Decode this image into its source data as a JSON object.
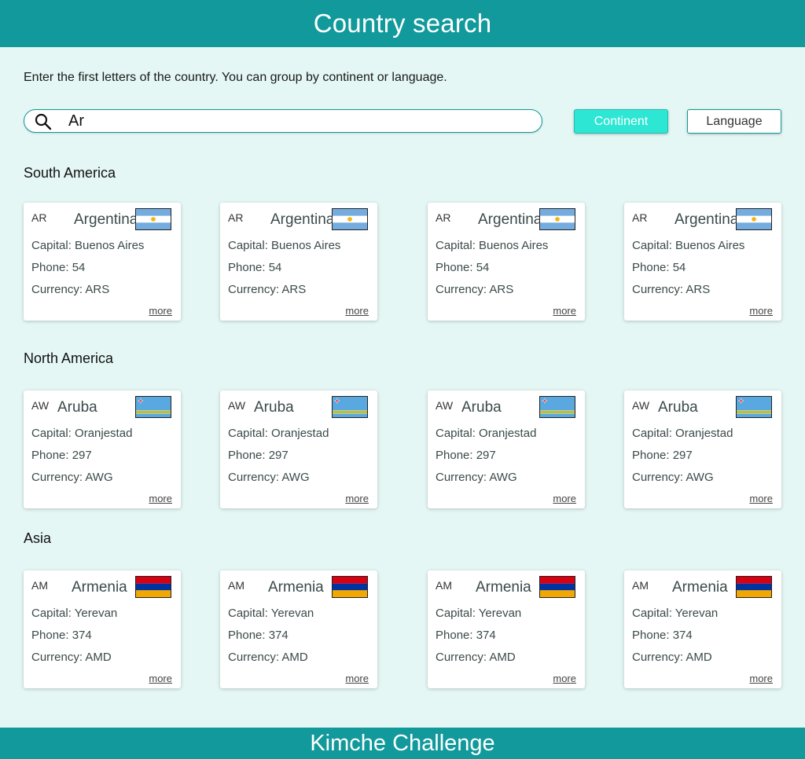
{
  "header": {
    "title": "Country search"
  },
  "instructions": "Enter the first letters of the country. You can group by continent or language.",
  "search": {
    "value": "Ar",
    "icon": "search-icon"
  },
  "group_buttons": {
    "continent": "Continent",
    "language": "Language"
  },
  "colors": {
    "primary": "#11999b",
    "accent": "#2ee6d4",
    "background": "#e4f7f4"
  },
  "labels": {
    "capital": "Capital: ",
    "phone": "Phone: ",
    "currency": "Currency: ",
    "more": "more"
  },
  "groups": [
    {
      "title": "South America",
      "cards": [
        {
          "code": "AR",
          "name": "Argentina",
          "capital": "Buenos Aires",
          "phone": "54",
          "currency": "ARS",
          "flag": "argentina-flag"
        },
        {
          "code": "AR",
          "name": "Argentina",
          "capital": "Buenos Aires",
          "phone": "54",
          "currency": "ARS",
          "flag": "argentina-flag"
        },
        {
          "code": "AR",
          "name": "Argentina",
          "capital": "Buenos Aires",
          "phone": "54",
          "currency": "ARS",
          "flag": "argentina-flag"
        },
        {
          "code": "AR",
          "name": "Argentina",
          "capital": "Buenos Aires",
          "phone": "54",
          "currency": "ARS",
          "flag": "argentina-flag"
        }
      ]
    },
    {
      "title": "North America",
      "cards": [
        {
          "code": "AW",
          "name": "Aruba",
          "capital": "Oranjestad",
          "phone": "297",
          "currency": "AWG",
          "flag": "aruba-flag"
        },
        {
          "code": "AW",
          "name": "Aruba",
          "capital": "Oranjestad",
          "phone": "297",
          "currency": "AWG",
          "flag": "aruba-flag"
        },
        {
          "code": "AW",
          "name": "Aruba",
          "capital": "Oranjestad",
          "phone": "297",
          "currency": "AWG",
          "flag": "aruba-flag"
        },
        {
          "code": "AW",
          "name": "Aruba",
          "capital": "Oranjestad",
          "phone": "297",
          "currency": "AWG",
          "flag": "aruba-flag"
        }
      ]
    },
    {
      "title": "Asia",
      "cards": [
        {
          "code": "AM",
          "name": "Armenia",
          "capital": "Yerevan",
          "phone": "374",
          "currency": "AMD",
          "flag": "armenia-flag"
        },
        {
          "code": "AM",
          "name": "Armenia",
          "capital": "Yerevan",
          "phone": "374",
          "currency": "AMD",
          "flag": "armenia-flag"
        },
        {
          "code": "AM",
          "name": "Armenia",
          "capital": "Yerevan",
          "phone": "374",
          "currency": "AMD",
          "flag": "armenia-flag"
        },
        {
          "code": "AM",
          "name": "Armenia",
          "capital": "Yerevan",
          "phone": "374",
          "currency": "AMD",
          "flag": "armenia-flag"
        }
      ]
    }
  ],
  "footer": {
    "text": "Kimche Challenge"
  }
}
